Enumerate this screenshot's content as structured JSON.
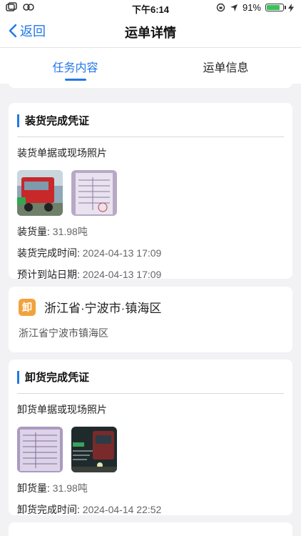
{
  "status": {
    "time": "下午6:14",
    "battery": "91%",
    "battery_level": 0.91
  },
  "nav": {
    "back_label": "返回",
    "title": "运单详情"
  },
  "tabs": [
    {
      "label": "任务内容",
      "active": true
    },
    {
      "label": "运单信息",
      "active": false
    }
  ],
  "loading": {
    "title": "装货完成凭证",
    "photos_label": "装货单据或现场照片",
    "photos": [
      {
        "icon": "truck-photo"
      },
      {
        "icon": "document-photo"
      }
    ],
    "amount_label": "装货量: ",
    "amount_value": "31.98吨",
    "time_label": "装货完成时间: ",
    "time_value": "2024-04-13 17:09",
    "eta_label": "预计到站日期: ",
    "eta_value": "2024-04-13 17:09"
  },
  "unload_address": {
    "icon_text": "卸",
    "title": "浙江省·宁波市·镇海区",
    "detail": "浙江省宁波市镇海区"
  },
  "unloading": {
    "title": "卸货完成凭证",
    "photos_label": "卸货单据或现场照片",
    "photos": [
      {
        "icon": "document-photo"
      },
      {
        "icon": "truck-night-photo"
      }
    ],
    "amount_label": "卸货量: ",
    "amount_value": "31.98吨",
    "time_label": "卸货完成时间: ",
    "time_value": "2024-04-14 22:52"
  }
}
